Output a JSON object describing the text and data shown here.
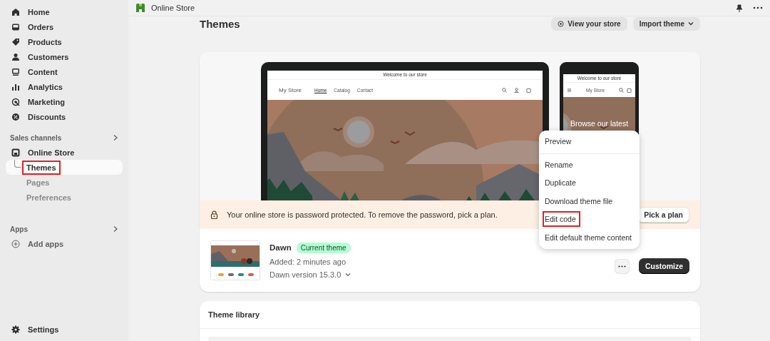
{
  "sidebar": {
    "items": [
      {
        "label": "Home"
      },
      {
        "label": "Orders"
      },
      {
        "label": "Products"
      },
      {
        "label": "Customers"
      },
      {
        "label": "Content"
      },
      {
        "label": "Analytics"
      },
      {
        "label": "Marketing"
      },
      {
        "label": "Discounts"
      }
    ],
    "sales_channels": {
      "label": "Sales channels",
      "store": {
        "label": "Online Store",
        "children": [
          {
            "label": "Themes",
            "selected": true,
            "highlighted": true
          },
          {
            "label": "Pages",
            "selected": false,
            "highlighted": false
          },
          {
            "label": "Preferences",
            "selected": false,
            "highlighted": false
          }
        ]
      }
    },
    "apps": {
      "label": "Apps",
      "add": "Add apps"
    },
    "settings": "Settings"
  },
  "top_bar": {
    "title": "Online Store"
  },
  "page": {
    "title": "Themes",
    "actions": [
      "View your store",
      "Import theme"
    ]
  },
  "preview": {
    "desktop": {
      "announcement": "Welcome to our store",
      "store_name": "My Store",
      "nav": [
        {
          "label": "Home",
          "selected": true
        },
        {
          "label": "Catalog",
          "selected": false
        },
        {
          "label": "Contact",
          "selected": false
        }
      ]
    },
    "mobile": {
      "announcement": "Welcome to our store",
      "store_name": "My Store",
      "headline": "Browse our latest"
    }
  },
  "banner": {
    "text": "Your online store is password protected. To remove the password, pick a plan.",
    "button": "Pick a plan"
  },
  "current_theme": {
    "name": "Dawn",
    "badge": "Current theme",
    "added": "Added: 2 minutes ago",
    "version": "Dawn version 15.3.0",
    "button": "Customize"
  },
  "menu": {
    "groups": [
      [
        {
          "label": "Preview",
          "highlighted": false
        }
      ],
      [
        {
          "label": "Rename",
          "highlighted": false
        },
        {
          "label": "Duplicate",
          "highlighted": false
        },
        {
          "label": "Download theme file",
          "highlighted": false
        },
        {
          "label": "Edit code",
          "highlighted": true
        },
        {
          "label": "Edit default theme content",
          "highlighted": false
        }
      ]
    ]
  },
  "library": {
    "title": "Theme library"
  }
}
